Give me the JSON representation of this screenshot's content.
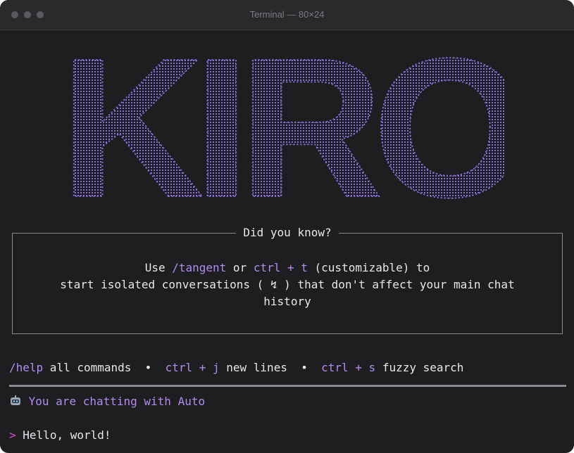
{
  "window": {
    "title": "Terminal — 80×24"
  },
  "logo": {
    "text": "KIRO",
    "color": "#8a6fe0"
  },
  "tip": {
    "heading": "Did you know?",
    "line1_pre": "Use ",
    "cmd1": "/tangent",
    "line1_mid": " or ",
    "cmd2": "ctrl + t",
    "line1_post": " (customizable) to",
    "line2": "start isolated conversations ( ↯ ) that don't affect your main chat",
    "line3": "history"
  },
  "hints": {
    "cmd_help": "/help",
    "help_label": " all commands  •  ",
    "key_newline": "ctrl + j",
    "newline_label": " new lines  •  ",
    "key_search": "ctrl + s",
    "search_label": " fuzzy search"
  },
  "chat": {
    "icon": "robot-icon",
    "status": "You are chatting with Auto"
  },
  "prompt": {
    "symbol": ">",
    "input": "Hello, world!"
  },
  "colors": {
    "accent": "#b08cf0",
    "prompt": "#d94fd1",
    "background": "#1e1d20"
  }
}
